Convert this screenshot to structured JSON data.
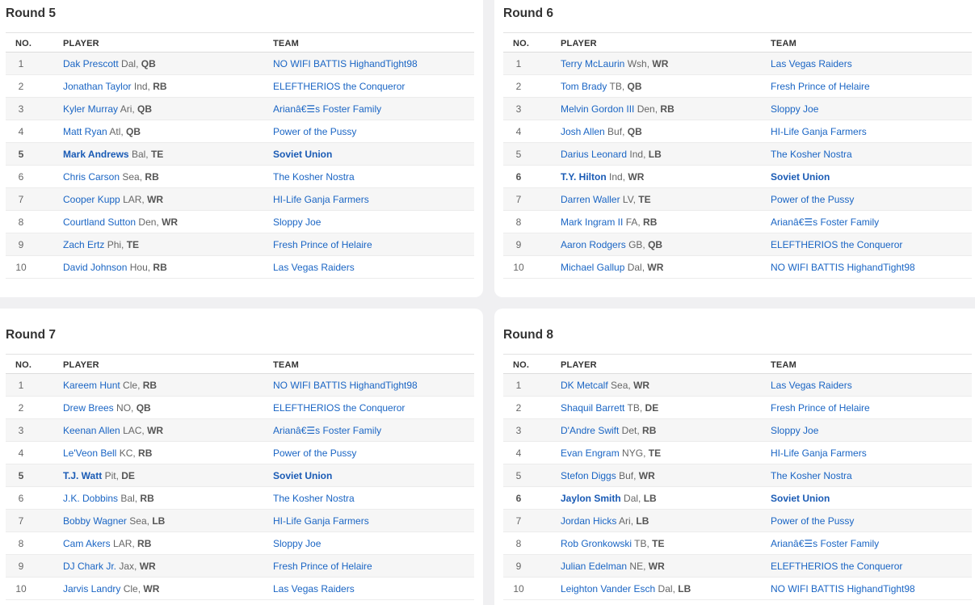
{
  "headers": {
    "no": "NO.",
    "player": "PLAYER",
    "team": "TEAM"
  },
  "rounds": [
    {
      "title": "Round 5",
      "picks": [
        {
          "no": "1",
          "player": "Dak Prescott",
          "team_abbr": "Dal",
          "pos": "QB",
          "team": "NO WIFI BATTIS HighandTight98",
          "mine": false
        },
        {
          "no": "2",
          "player": "Jonathan Taylor",
          "team_abbr": "Ind",
          "pos": "RB",
          "team": "ELEFTHERIOS the Conqueror",
          "mine": false
        },
        {
          "no": "3",
          "player": "Kyler Murray",
          "team_abbr": "Ari",
          "pos": "QB",
          "team": "Arianâ€☰s Foster Family",
          "mine": false
        },
        {
          "no": "4",
          "player": "Matt Ryan",
          "team_abbr": "Atl",
          "pos": "QB",
          "team": "Power of the Pussy",
          "mine": false
        },
        {
          "no": "5",
          "player": "Mark Andrews",
          "team_abbr": "Bal",
          "pos": "TE",
          "team": "Soviet Union",
          "mine": true
        },
        {
          "no": "6",
          "player": "Chris Carson",
          "team_abbr": "Sea",
          "pos": "RB",
          "team": "The Kosher Nostra",
          "mine": false
        },
        {
          "no": "7",
          "player": "Cooper Kupp",
          "team_abbr": "LAR",
          "pos": "WR",
          "team": "HI-Life Ganja Farmers",
          "mine": false
        },
        {
          "no": "8",
          "player": "Courtland Sutton",
          "team_abbr": "Den",
          "pos": "WR",
          "team": "Sloppy Joe",
          "mine": false
        },
        {
          "no": "9",
          "player": "Zach Ertz",
          "team_abbr": "Phi",
          "pos": "TE",
          "team": "Fresh Prince of Helaire",
          "mine": false
        },
        {
          "no": "10",
          "player": "David Johnson",
          "team_abbr": "Hou",
          "pos": "RB",
          "team": "Las Vegas Raiders",
          "mine": false
        }
      ]
    },
    {
      "title": "Round 6",
      "picks": [
        {
          "no": "1",
          "player": "Terry McLaurin",
          "team_abbr": "Wsh",
          "pos": "WR",
          "team": "Las Vegas Raiders",
          "mine": false
        },
        {
          "no": "2",
          "player": "Tom Brady",
          "team_abbr": "TB",
          "pos": "QB",
          "team": "Fresh Prince of Helaire",
          "mine": false
        },
        {
          "no": "3",
          "player": "Melvin Gordon III",
          "team_abbr": "Den",
          "pos": "RB",
          "team": "Sloppy Joe",
          "mine": false
        },
        {
          "no": "4",
          "player": "Josh Allen",
          "team_abbr": "Buf",
          "pos": "QB",
          "team": "HI-Life Ganja Farmers",
          "mine": false
        },
        {
          "no": "5",
          "player": "Darius Leonard",
          "team_abbr": "Ind",
          "pos": "LB",
          "team": "The Kosher Nostra",
          "mine": false
        },
        {
          "no": "6",
          "player": "T.Y. Hilton",
          "team_abbr": "Ind",
          "pos": "WR",
          "team": "Soviet Union",
          "mine": true
        },
        {
          "no": "7",
          "player": "Darren Waller",
          "team_abbr": "LV",
          "pos": "TE",
          "team": "Power of the Pussy",
          "mine": false
        },
        {
          "no": "8",
          "player": "Mark Ingram II",
          "team_abbr": "FA",
          "pos": "RB",
          "team": "Arianâ€☰s Foster Family",
          "mine": false
        },
        {
          "no": "9",
          "player": "Aaron Rodgers",
          "team_abbr": "GB",
          "pos": "QB",
          "team": "ELEFTHERIOS the Conqueror",
          "mine": false
        },
        {
          "no": "10",
          "player": "Michael Gallup",
          "team_abbr": "Dal",
          "pos": "WR",
          "team": "NO WIFI BATTIS HighandTight98",
          "mine": false
        }
      ]
    },
    {
      "title": "Round 7",
      "picks": [
        {
          "no": "1",
          "player": "Kareem Hunt",
          "team_abbr": "Cle",
          "pos": "RB",
          "team": "NO WIFI BATTIS HighandTight98",
          "mine": false
        },
        {
          "no": "2",
          "player": "Drew Brees",
          "team_abbr": "NO",
          "pos": "QB",
          "team": "ELEFTHERIOS the Conqueror",
          "mine": false
        },
        {
          "no": "3",
          "player": "Keenan Allen",
          "team_abbr": "LAC",
          "pos": "WR",
          "team": "Arianâ€☰s Foster Family",
          "mine": false
        },
        {
          "no": "4",
          "player": "Le'Veon Bell",
          "team_abbr": "KC",
          "pos": "RB",
          "team": "Power of the Pussy",
          "mine": false
        },
        {
          "no": "5",
          "player": "T.J. Watt",
          "team_abbr": "Pit",
          "pos": "DE",
          "team": "Soviet Union",
          "mine": true
        },
        {
          "no": "6",
          "player": "J.K. Dobbins",
          "team_abbr": "Bal",
          "pos": "RB",
          "team": "The Kosher Nostra",
          "mine": false
        },
        {
          "no": "7",
          "player": "Bobby Wagner",
          "team_abbr": "Sea",
          "pos": "LB",
          "team": "HI-Life Ganja Farmers",
          "mine": false
        },
        {
          "no": "8",
          "player": "Cam Akers",
          "team_abbr": "LAR",
          "pos": "RB",
          "team": "Sloppy Joe",
          "mine": false
        },
        {
          "no": "9",
          "player": "DJ Chark Jr.",
          "team_abbr": "Jax",
          "pos": "WR",
          "team": "Fresh Prince of Helaire",
          "mine": false
        },
        {
          "no": "10",
          "player": "Jarvis Landry",
          "team_abbr": "Cle",
          "pos": "WR",
          "team": "Las Vegas Raiders",
          "mine": false
        }
      ]
    },
    {
      "title": "Round 8",
      "picks": [
        {
          "no": "1",
          "player": "DK Metcalf",
          "team_abbr": "Sea",
          "pos": "WR",
          "team": "Las Vegas Raiders",
          "mine": false
        },
        {
          "no": "2",
          "player": "Shaquil Barrett",
          "team_abbr": "TB",
          "pos": "DE",
          "team": "Fresh Prince of Helaire",
          "mine": false
        },
        {
          "no": "3",
          "player": "D'Andre Swift",
          "team_abbr": "Det",
          "pos": "RB",
          "team": "Sloppy Joe",
          "mine": false
        },
        {
          "no": "4",
          "player": "Evan Engram",
          "team_abbr": "NYG",
          "pos": "TE",
          "team": "HI-Life Ganja Farmers",
          "mine": false
        },
        {
          "no": "5",
          "player": "Stefon Diggs",
          "team_abbr": "Buf",
          "pos": "WR",
          "team": "The Kosher Nostra",
          "mine": false
        },
        {
          "no": "6",
          "player": "Jaylon Smith",
          "team_abbr": "Dal",
          "pos": "LB",
          "team": "Soviet Union",
          "mine": true
        },
        {
          "no": "7",
          "player": "Jordan Hicks",
          "team_abbr": "Ari",
          "pos": "LB",
          "team": "Power of the Pussy",
          "mine": false
        },
        {
          "no": "8",
          "player": "Rob Gronkowski",
          "team_abbr": "TB",
          "pos": "TE",
          "team": "Arianâ€☰s Foster Family",
          "mine": false
        },
        {
          "no": "9",
          "player": "Julian Edelman",
          "team_abbr": "NE",
          "pos": "WR",
          "team": "ELEFTHERIOS the Conqueror",
          "mine": false
        },
        {
          "no": "10",
          "player": "Leighton Vander Esch",
          "team_abbr": "Dal",
          "pos": "LB",
          "team": "NO WIFI BATTIS HighandTight98",
          "mine": false
        }
      ]
    }
  ]
}
